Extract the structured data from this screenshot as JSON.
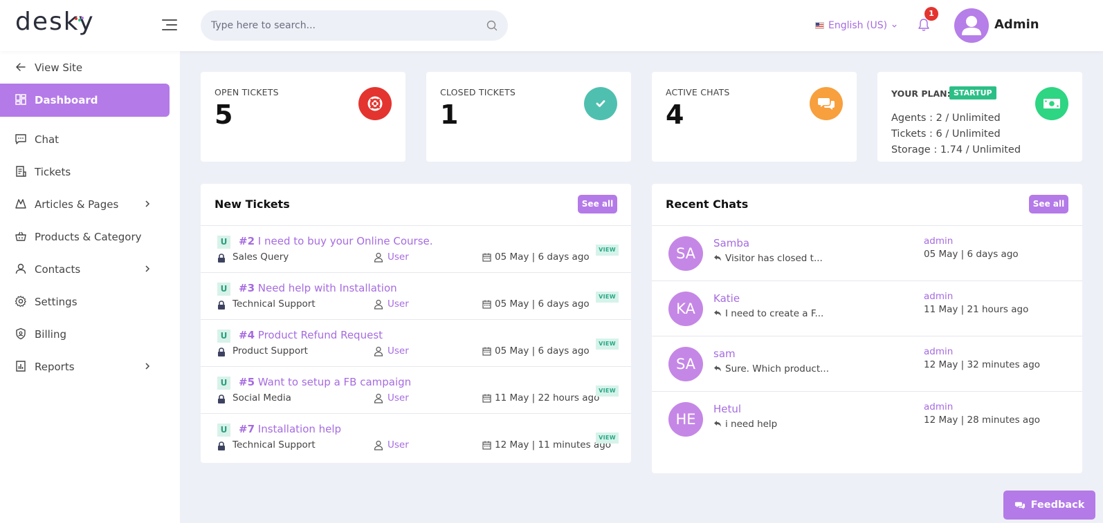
{
  "header": {
    "logo": "desky",
    "search_placeholder": "Type here to search...",
    "language": "English (US)",
    "notification_count": "1",
    "user_name": "Admin"
  },
  "sidebar": {
    "view_site": "View Site",
    "items": [
      {
        "label": "Dashboard",
        "icon": "dashboard-icon",
        "active": true
      },
      {
        "label": "Chat",
        "icon": "chat-icon"
      },
      {
        "label": "Tickets",
        "icon": "tickets-icon"
      },
      {
        "label": "Articles & Pages",
        "icon": "articles-icon",
        "has_submenu": true
      },
      {
        "label": "Products & Category",
        "icon": "basket-icon"
      },
      {
        "label": "Contacts",
        "icon": "user-icon",
        "has_submenu": true
      },
      {
        "label": "Settings",
        "icon": "gear-icon"
      },
      {
        "label": "Billing",
        "icon": "shield-icon"
      },
      {
        "label": "Reports",
        "icon": "reports-icon",
        "has_submenu": true
      }
    ]
  },
  "stats": {
    "open": {
      "label": "OPEN TICKETS",
      "value": "5",
      "color": "#e3342f"
    },
    "closed": {
      "label": "CLOSED TICKETS",
      "value": "1",
      "color": "#4fc0b0"
    },
    "chats": {
      "label": "ACTIVE CHATS",
      "value": "4",
      "color": "#f7a03d"
    },
    "plan": {
      "label": "YOUR PLAN:",
      "badge": "STARTUP",
      "color": "#2ed582",
      "lines": [
        "Agents : 2 / Unlimited",
        "Tickets : 6 / Unlimited",
        "Storage : 1.74 / Unlimited"
      ]
    }
  },
  "new_tickets": {
    "title": "New Tickets",
    "see_all": "See all",
    "rows": [
      {
        "badge": "U",
        "number": "#2",
        "title": "I need to buy your Online Course.",
        "category": "Sales Query",
        "user": "User",
        "date": "05 May | 6 days ago",
        "action": "VIEW"
      },
      {
        "badge": "U",
        "number": "#3",
        "title": "Need help with Installation",
        "category": "Technical Support",
        "user": "User",
        "date": "05 May | 6 days ago",
        "action": "VIEW"
      },
      {
        "badge": "U",
        "number": "#4",
        "title": "Product Refund Request",
        "category": "Product Support",
        "user": "User",
        "date": "05 May | 6 days ago",
        "action": "VIEW"
      },
      {
        "badge": "U",
        "number": "#5",
        "title": "Want to setup a FB campaign",
        "category": "Social Media",
        "user": "User",
        "date": "11 May | 22 hours ago",
        "action": "VIEW"
      },
      {
        "badge": "U",
        "number": "#7",
        "title": "Installation help",
        "category": "Technical Support",
        "user": "User",
        "date": "12 May | 11 minutes ago",
        "action": "VIEW"
      }
    ]
  },
  "recent_chats": {
    "title": "Recent Chats",
    "see_all": "See all",
    "rows": [
      {
        "initials": "SA",
        "name": "Samba",
        "message": "Visitor has closed t...",
        "agent": "admin",
        "time": "05 May | 6 days ago"
      },
      {
        "initials": "KA",
        "name": "Katie",
        "message": "I need to create a F...",
        "agent": "admin",
        "time": "11 May | 21 hours ago"
      },
      {
        "initials": "SA",
        "name": "sam",
        "message": "Sure. Which product...",
        "agent": "admin",
        "time": "12 May | 32 minutes ago"
      },
      {
        "initials": "HE",
        "name": "Hetul",
        "message": "i need help",
        "agent": "admin",
        "time": "12 May | 28 minutes ago"
      }
    ]
  },
  "feedback_label": "Feedback"
}
